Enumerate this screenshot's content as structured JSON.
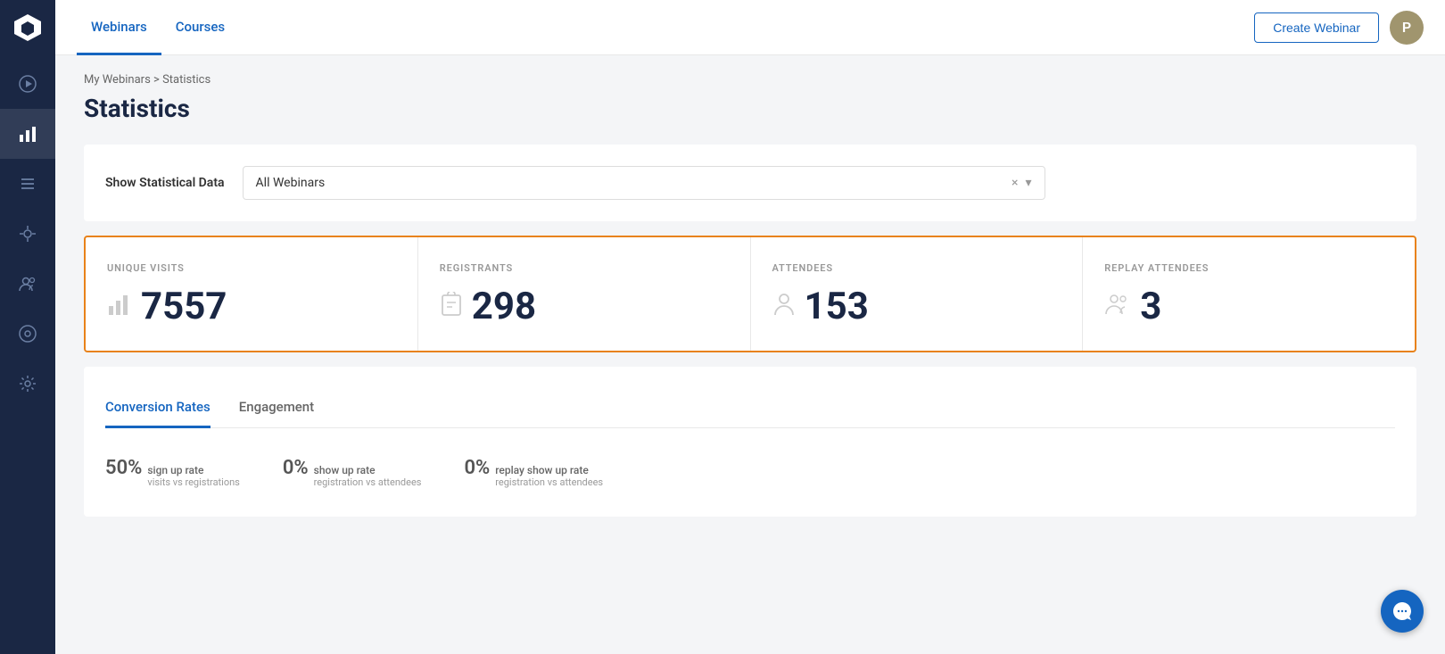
{
  "sidebar": {
    "items": [
      {
        "name": "play-icon",
        "icon": "▶",
        "active": false
      },
      {
        "name": "chart-icon",
        "icon": "📊",
        "active": true
      },
      {
        "name": "list-icon",
        "icon": "☰",
        "active": false
      },
      {
        "name": "integrations-icon",
        "icon": "✦",
        "active": false
      },
      {
        "name": "contacts-icon",
        "icon": "👥",
        "active": false
      },
      {
        "name": "settings-circle-icon",
        "icon": "◎",
        "active": false
      },
      {
        "name": "settings-icon",
        "icon": "⚙",
        "active": false
      }
    ]
  },
  "topnav": {
    "tabs": [
      {
        "label": "Webinars",
        "active": true
      },
      {
        "label": "Courses",
        "active": false
      }
    ],
    "create_button": "Create Webinar",
    "avatar_initial": "P"
  },
  "breadcrumb": {
    "parent": "My Webinars",
    "separator": ">",
    "current": "Statistics"
  },
  "page": {
    "title": "Statistics"
  },
  "filter": {
    "label": "Show Statistical Data",
    "value": "All Webinars",
    "clear_icon": "×",
    "dropdown_icon": "▾"
  },
  "stats": [
    {
      "label": "UNIQUE VISITS",
      "value": "7557",
      "icon": "bar-chart-icon"
    },
    {
      "label": "REGISTRANTS",
      "value": "298",
      "icon": "clipboard-icon"
    },
    {
      "label": "ATTENDEES",
      "value": "153",
      "icon": "person-icon"
    },
    {
      "label": "REPLAY ATTENDEES",
      "value": "3",
      "icon": "persons-icon"
    }
  ],
  "section_tabs": [
    {
      "label": "Conversion Rates",
      "active": true
    },
    {
      "label": "Engagement",
      "active": false
    }
  ],
  "conversion_rates": [
    {
      "percentage": "50%",
      "title": "sign up rate",
      "subtitle": "visits vs registrations"
    },
    {
      "percentage": "0%",
      "title": "show up rate",
      "subtitle": "registration vs attendees"
    },
    {
      "percentage": "0%",
      "title": "replay show up rate",
      "subtitle": "registration vs attendees"
    }
  ],
  "chat_icon": "💬"
}
